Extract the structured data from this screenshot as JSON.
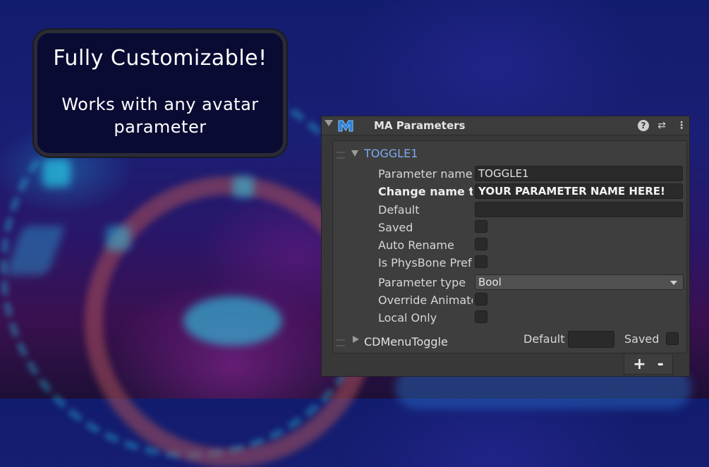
{
  "callout": {
    "title": "Fully Customizable!",
    "subtitle": "Works with any avatar parameter"
  },
  "panel": {
    "title": "MA Parameters",
    "icons": {
      "fold": "fold-down-icon",
      "logo": "modular-avatar-logo-icon",
      "help": "help-icon",
      "presets": "presets-sliders-icon",
      "menu": "kebab-menu-icon"
    },
    "help_glyph": "?",
    "preset_glyph": "⇄",
    "menu_glyph": "⋮",
    "entries": [
      {
        "name": "TOGGLE1",
        "expanded": true,
        "rows": {
          "parameter_name": {
            "label": "Parameter name",
            "value": "TOGGLE1"
          },
          "change_name": {
            "label": "Change name t",
            "value": "YOUR PARAMETER NAME HERE!"
          },
          "default": {
            "label": "Default",
            "value": ""
          },
          "saved": {
            "label": "Saved",
            "checked": false
          },
          "auto_rename": {
            "label": "Auto Rename",
            "checked": false
          },
          "is_physbone_prefix": {
            "label": "Is PhysBone Pref",
            "checked": false
          },
          "parameter_type": {
            "label": "Parameter type",
            "value": "Bool"
          },
          "override_animator": {
            "label": "Override Animato",
            "checked": false
          },
          "local_only": {
            "label": "Local Only",
            "checked": false
          }
        }
      },
      {
        "name": "CDMenuToggle",
        "expanded": false,
        "default_label": "Default",
        "default_value": "",
        "saved_label": "Saved",
        "saved_checked": false
      }
    ],
    "add_label": "+",
    "remove_label": "-"
  }
}
